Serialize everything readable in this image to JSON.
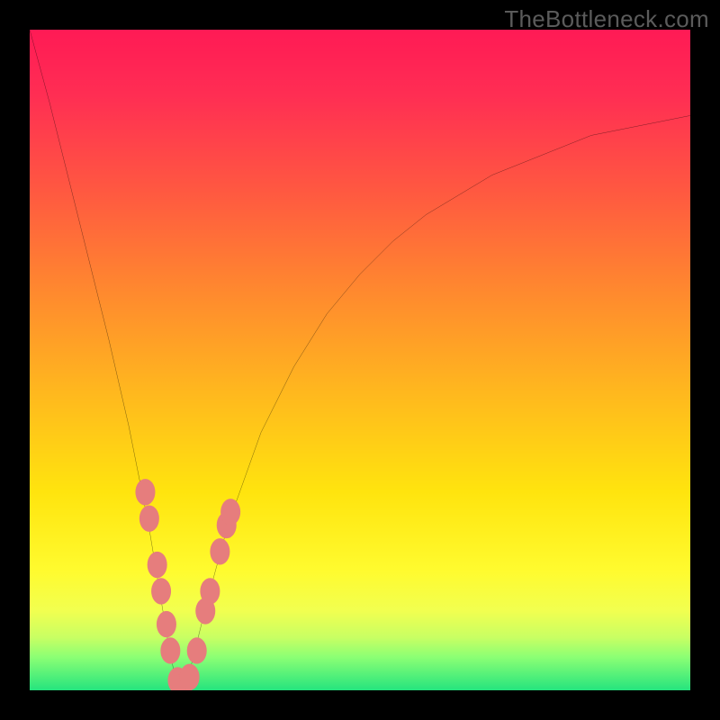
{
  "watermark": "TheBottleneck.com",
  "chart_data": {
    "type": "line",
    "title": "",
    "xlabel": "",
    "ylabel": "",
    "xlim": [
      0,
      100
    ],
    "ylim": [
      0,
      100
    ],
    "notch_x": 23,
    "series": [
      {
        "name": "curve",
        "x": [
          0,
          3,
          6,
          9,
          12,
          15,
          18,
          20,
          21,
          22,
          23,
          24,
          25,
          27,
          30,
          35,
          40,
          45,
          50,
          55,
          60,
          65,
          70,
          75,
          80,
          85,
          90,
          95,
          100
        ],
        "y": [
          100,
          89,
          77,
          65,
          53,
          40,
          25,
          13,
          7,
          2,
          0,
          2,
          6,
          14,
          25,
          39,
          49,
          57,
          63,
          68,
          72,
          75,
          78,
          80,
          82,
          84,
          85,
          86,
          87
        ]
      }
    ],
    "beads": {
      "left": [
        {
          "x": 17.5,
          "y": 30
        },
        {
          "x": 18.1,
          "y": 26
        },
        {
          "x": 19.3,
          "y": 19
        },
        {
          "x": 19.9,
          "y": 15
        },
        {
          "x": 20.7,
          "y": 10
        },
        {
          "x": 21.3,
          "y": 6
        },
        {
          "x": 22.4,
          "y": 1.5
        },
        {
          "x": 23.1,
          "y": 0.5
        }
      ],
      "right": [
        {
          "x": 24.2,
          "y": 2
        },
        {
          "x": 25.3,
          "y": 6
        },
        {
          "x": 26.6,
          "y": 12
        },
        {
          "x": 27.3,
          "y": 15
        },
        {
          "x": 28.8,
          "y": 21
        },
        {
          "x": 29.8,
          "y": 25
        },
        {
          "x": 30.4,
          "y": 27
        }
      ],
      "color": "#e67d7d",
      "rx": 1.5,
      "ry": 2.0
    },
    "gradient_bands_note": "Background encodes value: red=high bottleneck, green=low"
  }
}
